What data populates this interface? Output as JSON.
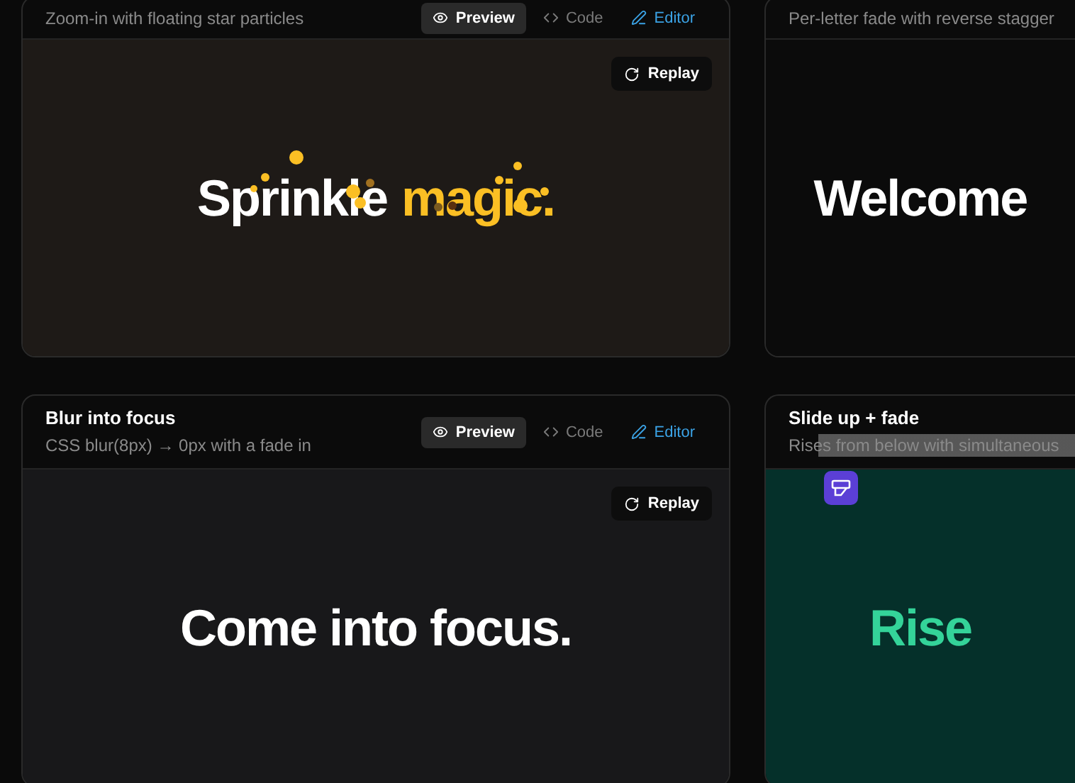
{
  "cards": [
    {
      "subtitle": "Zoom-in with floating star particles",
      "kind": "warm",
      "particles": true,
      "tabs": [
        {
          "label": "Preview",
          "selected": true,
          "kind": "tab"
        },
        {
          "label": "Code",
          "selected": false,
          "kind": "tab"
        },
        {
          "label": "Editor",
          "selected": false,
          "kind": "link"
        }
      ],
      "replay": "Replay",
      "words": [
        {
          "text": "Sprinkle",
          "accent": false
        },
        {
          "text": "magic.",
          "accent": true
        }
      ]
    },
    {
      "subtitle": "Per-letter fade with reverse stagger",
      "kind": "dark",
      "words": [
        {
          "text": "Welcome",
          "accent": false
        }
      ]
    },
    {
      "title": "Blur into focus",
      "subtitle": "CSS blur(8px) → 0px with a fade in",
      "kind": "neutral",
      "tabs": [
        {
          "label": "Preview",
          "selected": true,
          "kind": "tab"
        },
        {
          "label": "Code",
          "selected": false,
          "kind": "tab"
        },
        {
          "label": "Editor",
          "selected": false,
          "kind": "link"
        }
      ],
      "replay": "Replay",
      "words": [
        {
          "text": "Come into focus.",
          "accent": false
        }
      ]
    },
    {
      "title": "Slide up + fade",
      "subtitle": "Rises from below with simultaneous",
      "kind": "green",
      "highlight": true,
      "words": [
        {
          "text": "Rise",
          "accent": false
        }
      ]
    }
  ]
}
